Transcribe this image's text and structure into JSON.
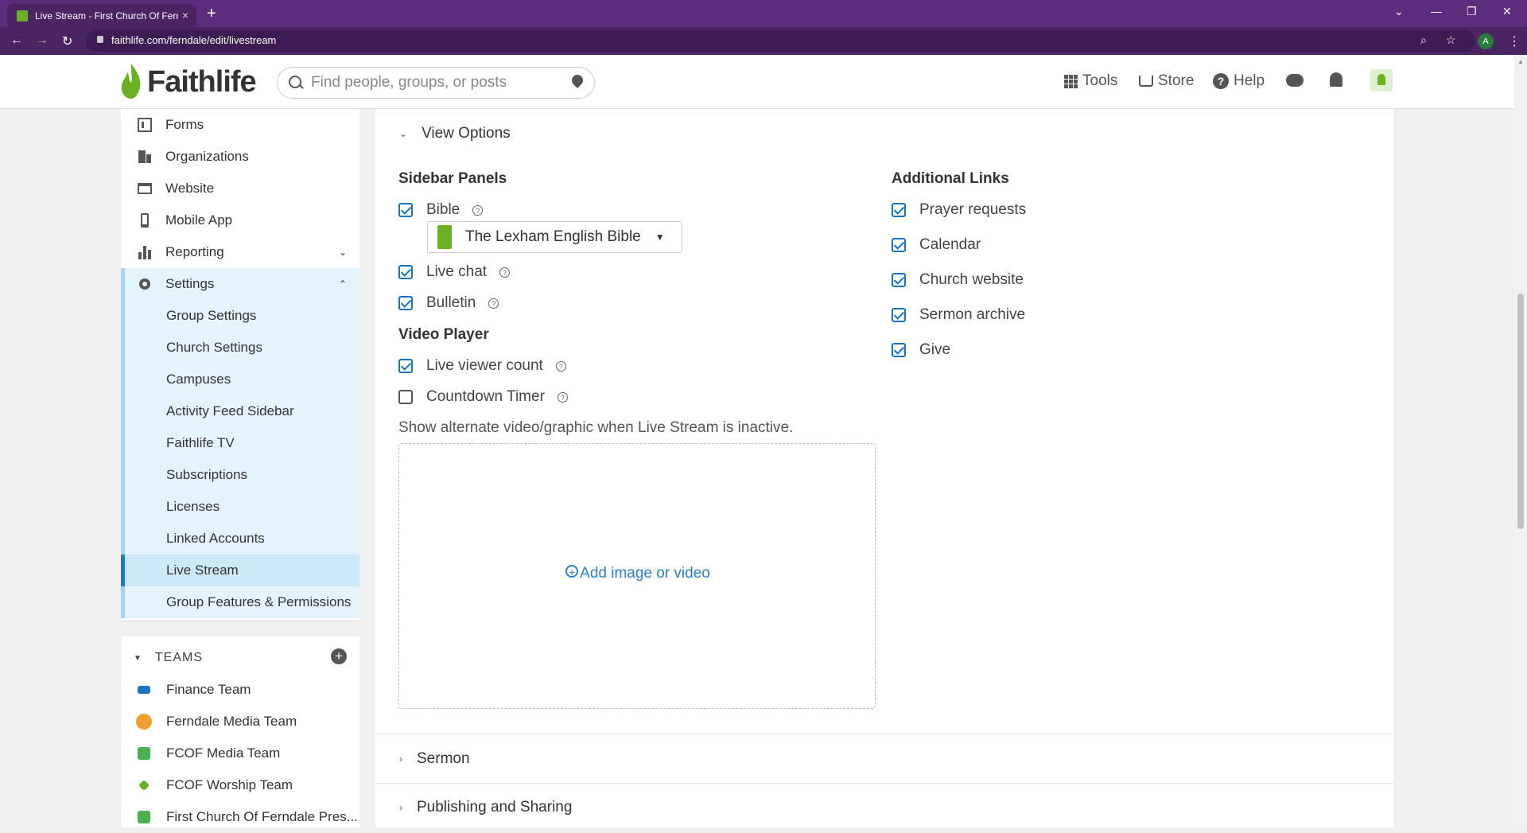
{
  "browser": {
    "tab_title": "Live Stream - First Church Of Ferndale",
    "tab_close": "×",
    "new_tab": "+",
    "url": "faithlife.com/ferndale/edit/livestream",
    "profile_initial": "A",
    "window_controls": [
      "⌄",
      "—",
      "❐",
      "✕"
    ],
    "nav": [
      "←",
      "→",
      "↻"
    ]
  },
  "header": {
    "logo": "Faithlife",
    "search_placeholder": "Find people, groups, or posts",
    "nav": {
      "tools": "Tools",
      "store": "Store",
      "help": "Help"
    }
  },
  "sidebar": {
    "items": [
      {
        "label": "Forms",
        "icon": "forms-icon"
      },
      {
        "label": "Organizations",
        "icon": "building-icon"
      },
      {
        "label": "Website",
        "icon": "website-icon"
      },
      {
        "label": "Mobile App",
        "icon": "mobile-icon"
      },
      {
        "label": "Reporting",
        "icon": "bar-chart-icon"
      },
      {
        "label": "Settings",
        "icon": "gear-icon"
      }
    ],
    "settings_sub": [
      "Group Settings",
      "Church Settings",
      "Campuses",
      "Activity Feed Sidebar",
      "Faithlife TV",
      "Subscriptions",
      "Licenses",
      "Linked Accounts",
      "Live Stream",
      "Group Features & Permissions"
    ],
    "active_item": "Live Stream"
  },
  "teams": {
    "heading": "TEAMS",
    "items": [
      {
        "name": "Finance Team",
        "color": "#1a73c0"
      },
      {
        "name": "Ferndale Media Team",
        "color": "#f0a030"
      },
      {
        "name": "FCOF Media Team",
        "color": "#4caf50"
      },
      {
        "name": "FCOF Worship Team",
        "color": "#6ab023"
      },
      {
        "name": "First Church Of Ferndale Pres...",
        "color": "#4caf50"
      }
    ]
  },
  "view_options": {
    "title": "View Options",
    "sidebar_panels": {
      "title": "Sidebar Panels",
      "bible": {
        "label": "Bible",
        "checked": true,
        "selected": "The Lexham English Bible"
      },
      "live_chat": {
        "label": "Live chat",
        "checked": true
      },
      "bulletin": {
        "label": "Bulletin",
        "checked": true
      }
    },
    "video_player": {
      "title": "Video Player",
      "live_viewer_count": {
        "label": "Live viewer count",
        "checked": true
      },
      "countdown_timer": {
        "label": "Countdown Timer",
        "checked": false
      }
    },
    "alternate_hint": "Show alternate video/graphic when Live Stream is inactive.",
    "add_media": "Add image or video",
    "additional_links": {
      "title": "Additional Links",
      "items": [
        {
          "label": "Prayer requests",
          "checked": true
        },
        {
          "label": "Calendar",
          "checked": true
        },
        {
          "label": "Church website",
          "checked": true
        },
        {
          "label": "Sermon archive",
          "checked": true
        },
        {
          "label": "Give",
          "checked": true
        }
      ]
    }
  },
  "sections": {
    "sermon": "Sermon",
    "publishing": "Publishing and Sharing"
  },
  "colors": {
    "browser_frame": "#5c2d7a",
    "accent": "#1a73c0",
    "brand_green": "#6ab023",
    "active_nav": "#cde9f8"
  }
}
